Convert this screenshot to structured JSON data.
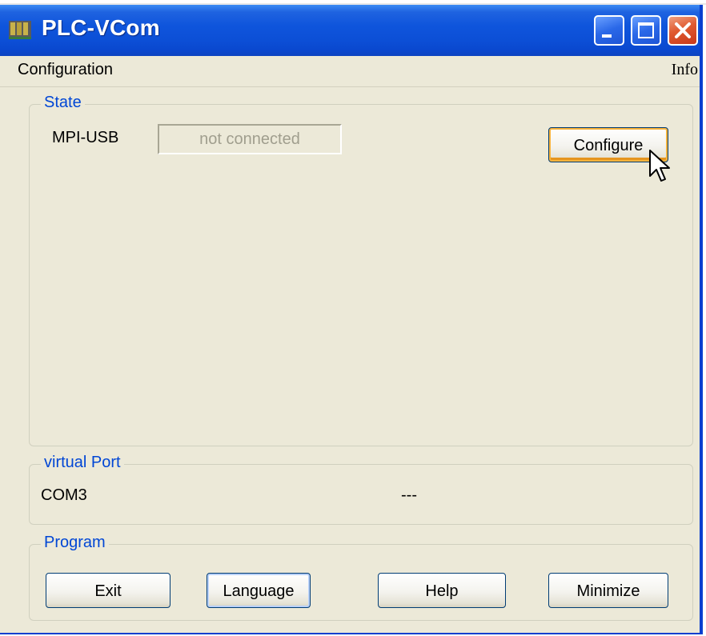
{
  "window": {
    "title": "PLC-VCom"
  },
  "menu": {
    "items": [
      "Configuration",
      "Info"
    ]
  },
  "state_group": {
    "label": "State",
    "device_label": "MPI-USB",
    "status_value": "not connected",
    "configure_button": "Configure"
  },
  "vport_group": {
    "label": "virtual Port",
    "port": "COM3",
    "value": "---"
  },
  "program_group": {
    "label": "Program",
    "buttons": [
      "Exit",
      "Language",
      "Help",
      "Minimize"
    ]
  },
  "icons": {
    "app": "plc-app-icon",
    "minimize": "minimize-icon",
    "maximize": "maximize-icon",
    "close": "close-icon",
    "cursor": "mouse-pointer-icon"
  },
  "colors": {
    "titlebar": "#0c4fd6",
    "group_label": "#0046d5",
    "window_bg": "#ece9d8",
    "close_button": "#e05a30"
  }
}
